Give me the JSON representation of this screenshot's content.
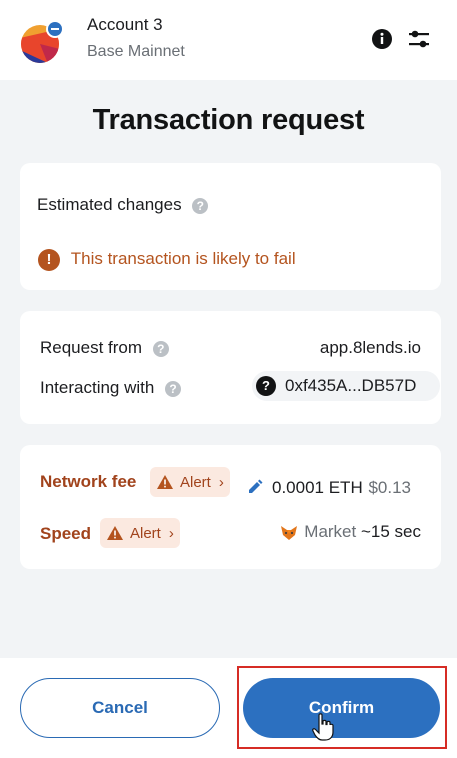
{
  "header": {
    "account_name": "Account 3",
    "network_name": "Base Mainnet",
    "info_icon": "info-icon",
    "settings_icon": "sliders-icon"
  },
  "page": {
    "title": "Transaction request"
  },
  "estimated_changes": {
    "label": "Estimated changes",
    "warning_text": "This transaction is likely to fail"
  },
  "request": {
    "request_from_label": "Request from",
    "request_from_value": "app.8lends.io",
    "interacting_with_label": "Interacting with",
    "interacting_with_value": "0xf435A...DB57D"
  },
  "fees": {
    "network_fee_label": "Network fee",
    "network_fee_alert": "Alert",
    "network_fee_eth": "0.0001 ETH",
    "network_fee_fiat": "$0.13",
    "speed_label": "Speed",
    "speed_alert": "Alert",
    "speed_value": "Market",
    "speed_time": "~15 sec"
  },
  "footer": {
    "cancel_label": "Cancel",
    "confirm_label": "Confirm"
  },
  "colors": {
    "accent": "#2c70c0",
    "warning": "#b4541f",
    "highlight": "#d62c25"
  }
}
